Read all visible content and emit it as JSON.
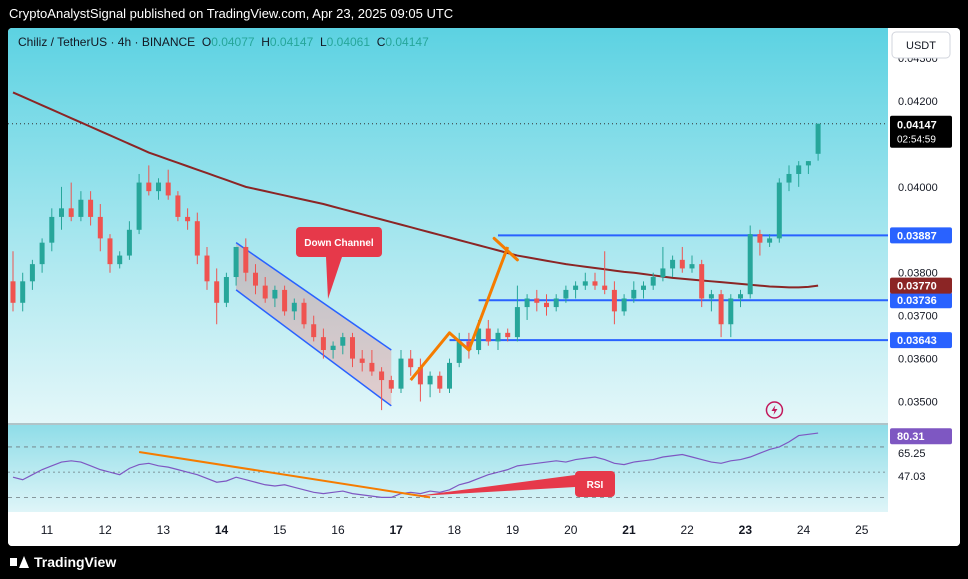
{
  "header": {
    "publisher_text": "CryptoAnalystSignal published on TradingView.com, Apr 23, 2025 09:05 UTC"
  },
  "symbol": {
    "name": "Chiliz / TetherUS · 4h · BINANCE",
    "o_label": "O",
    "o_val": "0.04077",
    "h_label": "H",
    "h_val": "0.04147",
    "l_label": "L",
    "l_val": "0.04061",
    "c_label": "C",
    "c_val": "0.04147"
  },
  "currency_button": "USDT",
  "footer": {
    "brand": "TradingView"
  },
  "colors": {
    "up": "#26a69a",
    "down": "#ef5350",
    "ma": "#8b2525",
    "level": "#2962ff",
    "arrow": "#f57c00",
    "rsi": "#7e57c2",
    "rsi_trend": "#f57c00",
    "bg_top": "#5fd3e3",
    "bg_bottom": "#d7f3f7"
  },
  "chart_data": {
    "type": "candlestick",
    "title": "Chiliz / TetherUS · 4h · BINANCE",
    "ylim": [
      0.0345,
      0.0437
    ],
    "x_ticks": [
      "11",
      "12",
      "13",
      "14",
      "15",
      "16",
      "17",
      "18",
      "19",
      "20",
      "21",
      "22",
      "23",
      "24",
      "25"
    ],
    "y_ticks": [
      "0.04300",
      "0.04200",
      "0.04000",
      "0.03800",
      "0.03700",
      "0.03600",
      "0.03500"
    ],
    "candles": [
      {
        "o": 0.0378,
        "h": 0.0385,
        "l": 0.0371,
        "c": 0.0373
      },
      {
        "o": 0.0373,
        "h": 0.038,
        "l": 0.0371,
        "c": 0.0378
      },
      {
        "o": 0.0378,
        "h": 0.0383,
        "l": 0.0376,
        "c": 0.0382
      },
      {
        "o": 0.0382,
        "h": 0.0388,
        "l": 0.038,
        "c": 0.0387
      },
      {
        "o": 0.0387,
        "h": 0.0395,
        "l": 0.0385,
        "c": 0.0393
      },
      {
        "o": 0.0393,
        "h": 0.04,
        "l": 0.039,
        "c": 0.0395
      },
      {
        "o": 0.0395,
        "h": 0.0401,
        "l": 0.0392,
        "c": 0.0393
      },
      {
        "o": 0.0393,
        "h": 0.0399,
        "l": 0.0392,
        "c": 0.0397
      },
      {
        "o": 0.0397,
        "h": 0.0399,
        "l": 0.0391,
        "c": 0.0393
      },
      {
        "o": 0.0393,
        "h": 0.0396,
        "l": 0.0385,
        "c": 0.0388
      },
      {
        "o": 0.0388,
        "h": 0.0389,
        "l": 0.038,
        "c": 0.0382
      },
      {
        "o": 0.0382,
        "h": 0.0385,
        "l": 0.0381,
        "c": 0.0384
      },
      {
        "o": 0.0384,
        "h": 0.0392,
        "l": 0.0383,
        "c": 0.039
      },
      {
        "o": 0.039,
        "h": 0.0403,
        "l": 0.0389,
        "c": 0.0401
      },
      {
        "o": 0.0401,
        "h": 0.0405,
        "l": 0.0398,
        "c": 0.0399
      },
      {
        "o": 0.0399,
        "h": 0.0402,
        "l": 0.0397,
        "c": 0.0401
      },
      {
        "o": 0.0401,
        "h": 0.0404,
        "l": 0.0397,
        "c": 0.0398
      },
      {
        "o": 0.0398,
        "h": 0.0399,
        "l": 0.0392,
        "c": 0.0393
      },
      {
        "o": 0.0393,
        "h": 0.0395,
        "l": 0.039,
        "c": 0.0392
      },
      {
        "o": 0.0392,
        "h": 0.0394,
        "l": 0.0382,
        "c": 0.0384
      },
      {
        "o": 0.0384,
        "h": 0.0386,
        "l": 0.0376,
        "c": 0.0378
      },
      {
        "o": 0.0378,
        "h": 0.0381,
        "l": 0.0368,
        "c": 0.0373
      },
      {
        "o": 0.0373,
        "h": 0.038,
        "l": 0.0372,
        "c": 0.0379
      },
      {
        "o": 0.0379,
        "h": 0.0385,
        "l": 0.0377,
        "c": 0.0386
      },
      {
        "o": 0.0386,
        "h": 0.0388,
        "l": 0.0378,
        "c": 0.038
      },
      {
        "o": 0.038,
        "h": 0.0382,
        "l": 0.0375,
        "c": 0.0377
      },
      {
        "o": 0.0377,
        "h": 0.0379,
        "l": 0.0373,
        "c": 0.0374
      },
      {
        "o": 0.0374,
        "h": 0.0377,
        "l": 0.0372,
        "c": 0.0376
      },
      {
        "o": 0.0376,
        "h": 0.0377,
        "l": 0.037,
        "c": 0.0371
      },
      {
        "o": 0.0371,
        "h": 0.0374,
        "l": 0.0369,
        "c": 0.0373
      },
      {
        "o": 0.0373,
        "h": 0.0374,
        "l": 0.0367,
        "c": 0.0368
      },
      {
        "o": 0.0368,
        "h": 0.037,
        "l": 0.0364,
        "c": 0.0365
      },
      {
        "o": 0.0365,
        "h": 0.0367,
        "l": 0.036,
        "c": 0.0362
      },
      {
        "o": 0.0362,
        "h": 0.0364,
        "l": 0.036,
        "c": 0.0363
      },
      {
        "o": 0.0363,
        "h": 0.0366,
        "l": 0.0361,
        "c": 0.0365
      },
      {
        "o": 0.0365,
        "h": 0.0366,
        "l": 0.0358,
        "c": 0.036
      },
      {
        "o": 0.036,
        "h": 0.0362,
        "l": 0.0357,
        "c": 0.0359
      },
      {
        "o": 0.0359,
        "h": 0.0362,
        "l": 0.0356,
        "c": 0.0357
      },
      {
        "o": 0.0357,
        "h": 0.0358,
        "l": 0.0348,
        "c": 0.0355
      },
      {
        "o": 0.0355,
        "h": 0.0356,
        "l": 0.0352,
        "c": 0.0353
      },
      {
        "o": 0.0353,
        "h": 0.0362,
        "l": 0.0352,
        "c": 0.036
      },
      {
        "o": 0.036,
        "h": 0.0362,
        "l": 0.0356,
        "c": 0.0358
      },
      {
        "o": 0.0358,
        "h": 0.036,
        "l": 0.035,
        "c": 0.0354
      },
      {
        "o": 0.0354,
        "h": 0.0357,
        "l": 0.0351,
        "c": 0.0356
      },
      {
        "o": 0.0356,
        "h": 0.0357,
        "l": 0.0352,
        "c": 0.0353
      },
      {
        "o": 0.0353,
        "h": 0.036,
        "l": 0.0352,
        "c": 0.0359
      },
      {
        "o": 0.0359,
        "h": 0.0366,
        "l": 0.0358,
        "c": 0.0364
      },
      {
        "o": 0.0364,
        "h": 0.0366,
        "l": 0.036,
        "c": 0.0362
      },
      {
        "o": 0.0362,
        "h": 0.0369,
        "l": 0.0361,
        "c": 0.0367
      },
      {
        "o": 0.0367,
        "h": 0.0369,
        "l": 0.0363,
        "c": 0.0364
      },
      {
        "o": 0.0364,
        "h": 0.0367,
        "l": 0.0362,
        "c": 0.0366
      },
      {
        "o": 0.0366,
        "h": 0.0367,
        "l": 0.0364,
        "c": 0.0365
      },
      {
        "o": 0.0365,
        "h": 0.0377,
        "l": 0.0364,
        "c": 0.0372
      },
      {
        "o": 0.0372,
        "h": 0.0375,
        "l": 0.0369,
        "c": 0.0374
      },
      {
        "o": 0.0374,
        "h": 0.0376,
        "l": 0.0371,
        "c": 0.0373
      },
      {
        "o": 0.0373,
        "h": 0.0375,
        "l": 0.037,
        "c": 0.0372
      },
      {
        "o": 0.0372,
        "h": 0.0375,
        "l": 0.0371,
        "c": 0.0374
      },
      {
        "o": 0.0374,
        "h": 0.0377,
        "l": 0.0373,
        "c": 0.0376
      },
      {
        "o": 0.0376,
        "h": 0.0378,
        "l": 0.0374,
        "c": 0.0377
      },
      {
        "o": 0.0377,
        "h": 0.038,
        "l": 0.0376,
        "c": 0.0378
      },
      {
        "o": 0.0378,
        "h": 0.038,
        "l": 0.0376,
        "c": 0.0377
      },
      {
        "o": 0.0377,
        "h": 0.0385,
        "l": 0.0375,
        "c": 0.0376
      },
      {
        "o": 0.0376,
        "h": 0.0378,
        "l": 0.0368,
        "c": 0.0371
      },
      {
        "o": 0.0371,
        "h": 0.0375,
        "l": 0.037,
        "c": 0.0374
      },
      {
        "o": 0.0374,
        "h": 0.0378,
        "l": 0.0373,
        "c": 0.0376
      },
      {
        "o": 0.0376,
        "h": 0.0378,
        "l": 0.0374,
        "c": 0.0377
      },
      {
        "o": 0.0377,
        "h": 0.038,
        "l": 0.0376,
        "c": 0.0379
      },
      {
        "o": 0.0379,
        "h": 0.0386,
        "l": 0.0378,
        "c": 0.0381
      },
      {
        "o": 0.0381,
        "h": 0.0384,
        "l": 0.0379,
        "c": 0.0383
      },
      {
        "o": 0.0383,
        "h": 0.0386,
        "l": 0.038,
        "c": 0.0381
      },
      {
        "o": 0.0381,
        "h": 0.0384,
        "l": 0.038,
        "c": 0.0382
      },
      {
        "o": 0.0382,
        "h": 0.0383,
        "l": 0.0372,
        "c": 0.0374
      },
      {
        "o": 0.0374,
        "h": 0.0376,
        "l": 0.0371,
        "c": 0.0375
      },
      {
        "o": 0.0375,
        "h": 0.0376,
        "l": 0.0365,
        "c": 0.0368
      },
      {
        "o": 0.0368,
        "h": 0.0375,
        "l": 0.0365,
        "c": 0.0374
      },
      {
        "o": 0.0374,
        "h": 0.0376,
        "l": 0.0372,
        "c": 0.0375
      },
      {
        "o": 0.0375,
        "h": 0.0391,
        "l": 0.0374,
        "c": 0.0389
      },
      {
        "o": 0.0389,
        "h": 0.039,
        "l": 0.0384,
        "c": 0.0387
      },
      {
        "o": 0.0387,
        "h": 0.0389,
        "l": 0.0386,
        "c": 0.0388
      },
      {
        "o": 0.0388,
        "h": 0.0402,
        "l": 0.0387,
        "c": 0.0401
      },
      {
        "o": 0.0401,
        "h": 0.0405,
        "l": 0.0399,
        "c": 0.0403
      },
      {
        "o": 0.0403,
        "h": 0.0406,
        "l": 0.04,
        "c": 0.0405
      },
      {
        "o": 0.0405,
        "h": 0.0406,
        "l": 0.0403,
        "c": 0.0406
      },
      {
        "o": 0.04077,
        "h": 0.04147,
        "l": 0.04061,
        "c": 0.04147
      }
    ],
    "moving_average": [
      0.0422,
      0.0421,
      0.042,
      0.0419,
      0.0418,
      0.0417,
      0.0416,
      0.0415,
      0.0414,
      0.0413,
      0.0412,
      0.0411,
      0.041,
      0.0409,
      0.0408,
      0.04072,
      0.04064,
      0.04056,
      0.04048,
      0.0404,
      0.04032,
      0.04024,
      0.04016,
      0.04008,
      0.04,
      0.03995,
      0.0399,
      0.03985,
      0.0398,
      0.03975,
      0.0397,
      0.03965,
      0.0396,
      0.03954,
      0.03948,
      0.03942,
      0.03936,
      0.0393,
      0.03924,
      0.03918,
      0.03912,
      0.03906,
      0.039,
      0.03894,
      0.03888,
      0.03882,
      0.03876,
      0.0387,
      0.03864,
      0.03858,
      0.03852,
      0.03846,
      0.0384,
      0.03836,
      0.03832,
      0.03828,
      0.03824,
      0.0382,
      0.03817,
      0.03814,
      0.03811,
      0.03808,
      0.03805,
      0.03802,
      0.038,
      0.03797,
      0.03794,
      0.03791,
      0.03788,
      0.03786,
      0.03784,
      0.03782,
      0.0378,
      0.03778,
      0.03776,
      0.03774,
      0.03772,
      0.0377,
      0.03768,
      0.03767,
      0.03766,
      0.03766,
      0.03767,
      0.0377
    ],
    "levels": [
      {
        "value": 0.03887,
        "label": "0.03887"
      },
      {
        "value": 0.03736,
        "label": "0.03736"
      },
      {
        "value": 0.03643,
        "label": "0.03643"
      }
    ],
    "ma_label": "0.03770",
    "last_price": {
      "label": "0.04147",
      "countdown": "02:54:59"
    },
    "annotation_channel": "Down Channel",
    "rsi": {
      "label": "RSI",
      "ylim": [
        20,
        85
      ],
      "ticks": [
        {
          "v": 65.25,
          "label": "65.25"
        },
        {
          "v": 47.03,
          "label": "47.03"
        }
      ],
      "current_label": "80.31",
      "values": [
        46,
        44,
        48,
        52,
        55,
        58,
        59,
        58,
        55,
        52,
        50,
        48,
        53,
        56,
        57,
        55,
        54,
        52,
        50,
        48,
        45,
        42,
        43,
        46,
        44,
        42,
        40,
        39,
        40,
        38,
        36,
        34,
        33,
        34,
        35,
        33,
        32,
        31,
        30,
        30,
        33,
        34,
        33,
        35,
        34,
        36,
        40,
        42,
        45,
        48,
        50,
        52,
        55,
        56,
        57,
        58,
        59,
        58,
        60,
        61,
        62,
        60,
        57,
        56,
        58,
        59,
        60,
        62,
        63,
        64,
        62,
        60,
        58,
        57,
        59,
        60,
        62,
        65,
        68,
        70,
        74,
        79,
        80,
        81
      ]
    }
  }
}
